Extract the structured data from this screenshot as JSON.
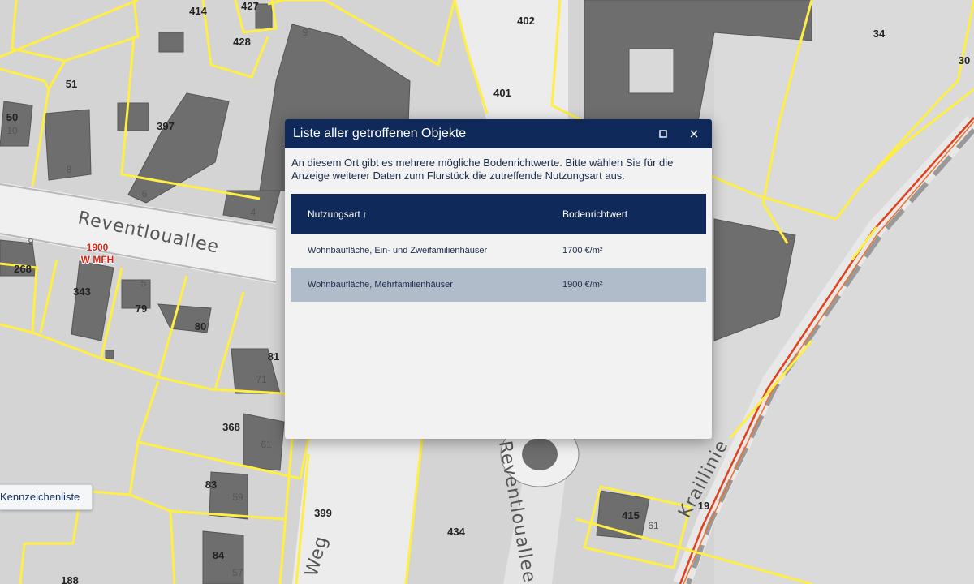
{
  "map": {
    "parcel_numbers": [
      "414",
      "427",
      "428",
      "402",
      "34",
      "30",
      "51",
      "50",
      "397",
      "401",
      "268",
      "343",
      "79",
      "80",
      "81",
      "368",
      "83",
      "399",
      "434",
      "415",
      "84",
      "188",
      "19"
    ],
    "house_numbers": [
      "10",
      "8",
      "6",
      "4",
      "5",
      "9",
      "71",
      "61",
      "59",
      "57",
      "61",
      "9"
    ],
    "streets": [
      "Reventlouallee",
      "Reventlouallee",
      "Weg",
      "Kraillinie"
    ],
    "land_value_label": {
      "value": "1900",
      "type": "W MFH"
    }
  },
  "side_panel": {
    "button_label": "Kennzeichenliste"
  },
  "dialog": {
    "title": "Liste aller getroffenen Objekte",
    "intro": "An diesem Ort gibt es mehrere mögliche Bodenrichtwerte. Bitte wählen Sie für die Anzeige weiterer Daten zum Flurstück die zutreffende Nutzungsart aus.",
    "columns": {
      "usage": "Nutzungsart",
      "value": "Bodenrichtwert"
    },
    "sort_indicator": "↑",
    "rows": [
      {
        "usage": "Wohnbaufläche, Ein- und Zweifamilienhäuser",
        "value": "1700 €/m²",
        "selected": false
      },
      {
        "usage": "Wohnbaufläche, Mehrfamilienhäuser",
        "value": "1900 €/m²",
        "selected": true
      }
    ]
  },
  "colors": {
    "header_navy": "#0f2a5a",
    "parcel_outline": "#ffee44",
    "building": "#6e6e6e",
    "road": "#f0f0f0",
    "rail": "#e0401a",
    "selected_row": "#b1bccb"
  }
}
